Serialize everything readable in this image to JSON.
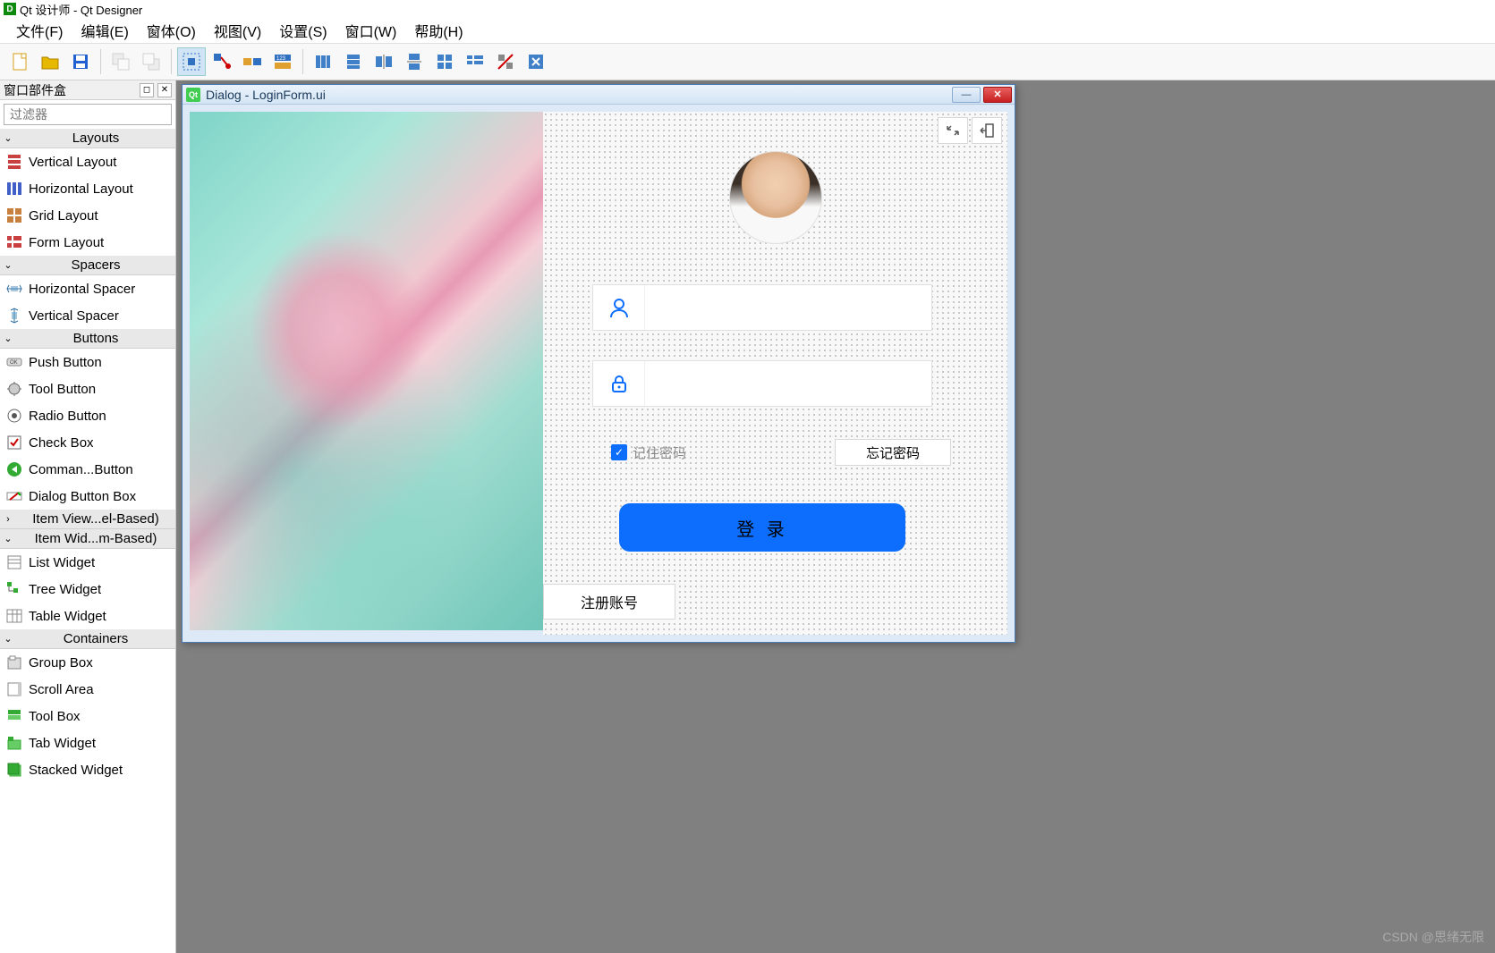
{
  "app": {
    "title": "Qt 设计师 - Qt Designer"
  },
  "menu": {
    "file": "文件(F)",
    "edit": "编辑(E)",
    "form": "窗体(O)",
    "view": "视图(V)",
    "settings": "设置(S)",
    "window": "窗口(W)",
    "help": "帮助(H)"
  },
  "dock": {
    "title": "窗口部件盒",
    "filter_placeholder": "过滤器",
    "categories": [
      {
        "label": "Layouts",
        "expanded": true,
        "items": [
          "Vertical Layout",
          "Horizontal Layout",
          "Grid Layout",
          "Form Layout"
        ]
      },
      {
        "label": "Spacers",
        "expanded": true,
        "items": [
          "Horizontal Spacer",
          "Vertical Spacer"
        ]
      },
      {
        "label": "Buttons",
        "expanded": true,
        "items": [
          "Push Button",
          "Tool Button",
          "Radio Button",
          "Check Box",
          "Comman...Button",
          "Dialog Button Box"
        ]
      },
      {
        "label": "Item View...el-Based)",
        "expanded": false,
        "items": []
      },
      {
        "label": "Item Wid...m-Based)",
        "expanded": true,
        "items": [
          "List Widget",
          "Tree Widget",
          "Table Widget"
        ]
      },
      {
        "label": "Containers",
        "expanded": true,
        "items": [
          "Group Box",
          "Scroll Area",
          "Tool Box",
          "Tab Widget",
          "Stacked Widget"
        ]
      }
    ]
  },
  "dialog": {
    "title": "Dialog - LoginForm.ui",
    "remember_label": "记住密码",
    "forgot_label": "忘记密码",
    "login_label": "登 录",
    "register_label": "注册账号"
  },
  "watermark": "CSDN @思绪无限"
}
